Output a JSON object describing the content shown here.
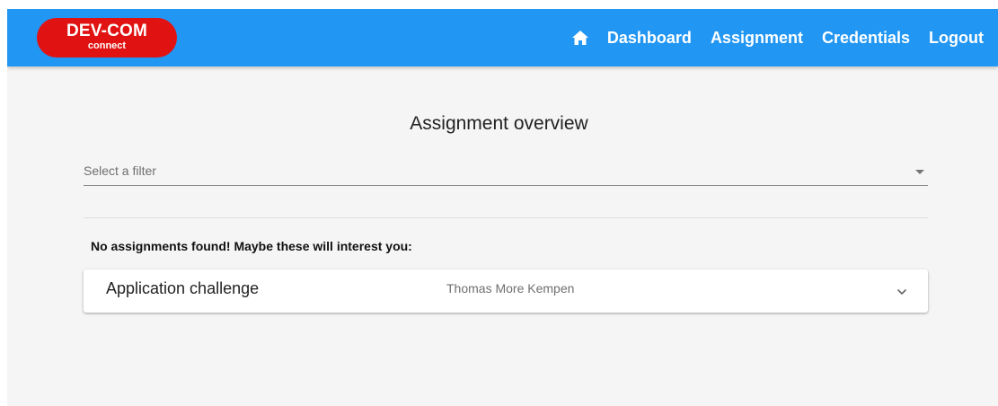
{
  "header": {
    "logo_main": "DEV-COM",
    "logo_sub": "connect",
    "nav": {
      "home_icon": "home-icon",
      "dashboard": "Dashboard",
      "assignment": "Assignment",
      "credentials": "Credentials",
      "logout": "Logout"
    }
  },
  "main": {
    "title": "Assignment overview",
    "filter_placeholder": "Select a filter",
    "empty_message": "No assignments found! Maybe these will interest you:",
    "suggestions": [
      {
        "title": "Application challenge",
        "company": "Thomas More Kempen"
      }
    ]
  },
  "colors": {
    "header_bg": "#2196f3",
    "logo_bg": "#e11212",
    "page_bg": "#f5f5f5"
  }
}
